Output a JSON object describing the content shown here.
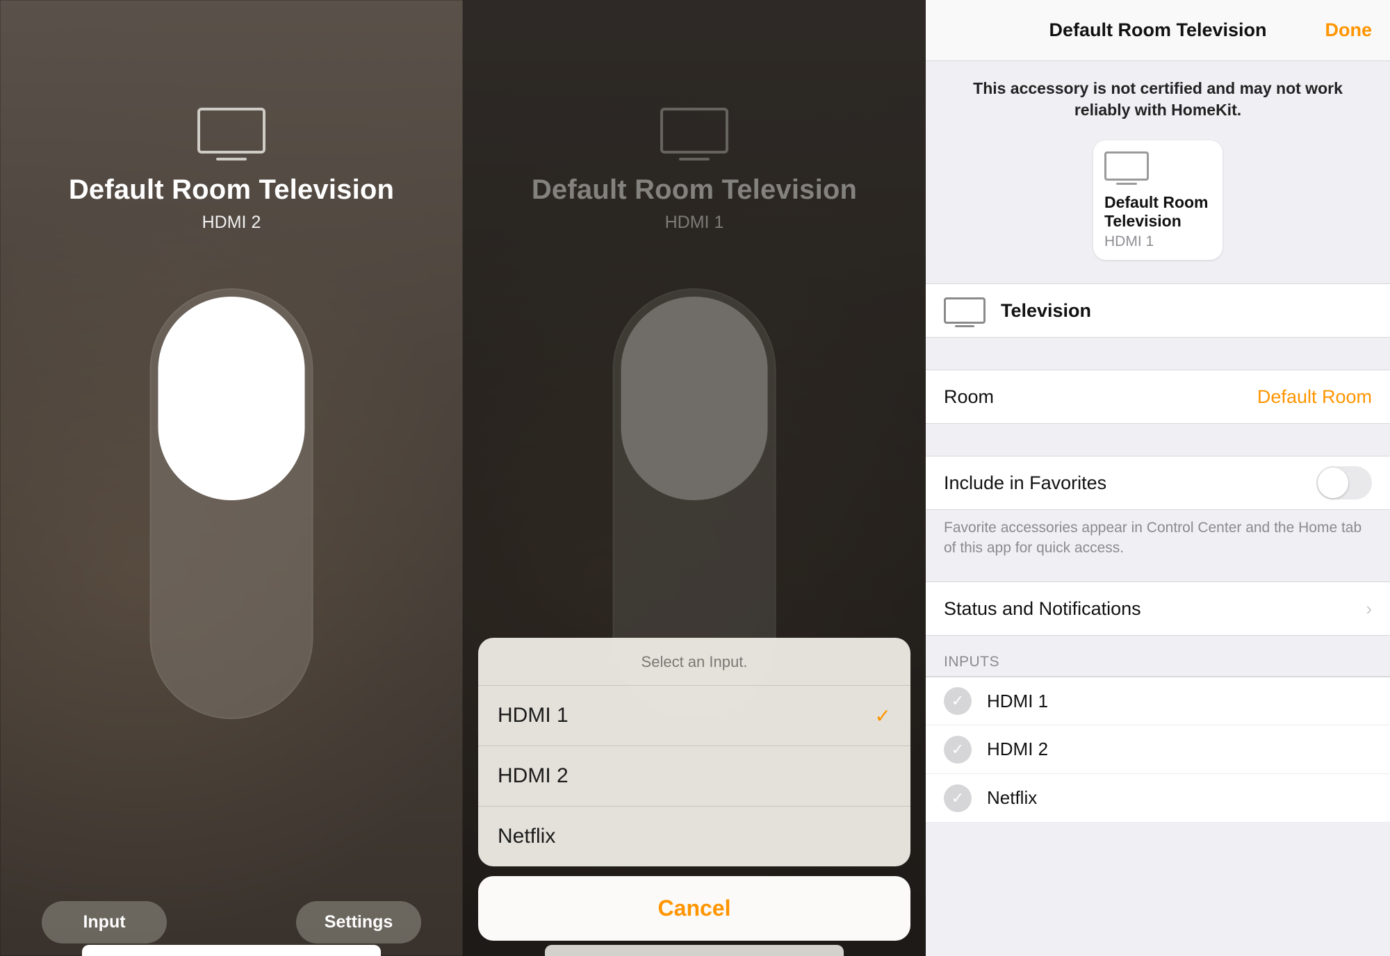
{
  "pane1": {
    "title": "Default Room Television",
    "subtitle": "HDMI 2",
    "buttons": {
      "input": "Input",
      "settings": "Settings"
    }
  },
  "pane2": {
    "title": "Default Room Television",
    "subtitle": "HDMI 1",
    "sheet": {
      "title": "Select an Input.",
      "items": [
        "HDMI 1",
        "HDMI 2",
        "Netflix"
      ],
      "selected_index": 0,
      "cancel": "Cancel"
    }
  },
  "pane3": {
    "nav_title": "Default Room Television",
    "done": "Done",
    "cert_warning": "This accessory is not certified and may not work reliably with HomeKit.",
    "tile": {
      "name": "Default Room Television",
      "sub": "HDMI 1"
    },
    "device_label": "Television",
    "room_row": {
      "label": "Room",
      "value": "Default Room"
    },
    "favorites": {
      "label": "Include in Favorites",
      "enabled": false,
      "footnote": "Favorite accessories appear in Control Center and the Home tab of this app for quick access."
    },
    "status_row": "Status and Notifications",
    "inputs_header": "INPUTS",
    "inputs": [
      "HDMI 1",
      "HDMI 2",
      "Netflix"
    ]
  }
}
